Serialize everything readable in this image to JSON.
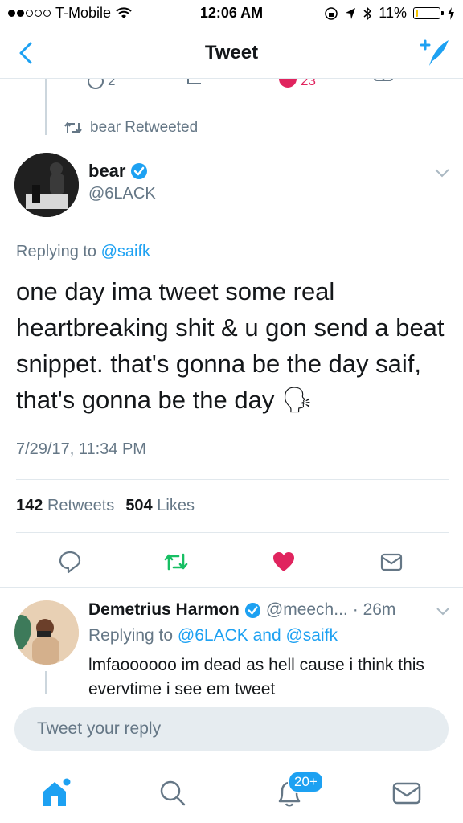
{
  "status": {
    "carrier": "T-Mobile",
    "time": "12:06 AM",
    "battery": "11%",
    "battery_level": 0.11
  },
  "nav": {
    "title": "Tweet"
  },
  "previous_tweet_actions": {
    "reply_count": "2",
    "like_count": "23"
  },
  "retweet_context": "bear Retweeted",
  "tweet": {
    "name": "bear",
    "handle": "@6LACK",
    "replying_prefix": "Replying to",
    "replying_to": "@saifk",
    "text": "one day ima tweet some real heartbreaking shit & u gon send a beat snippet. that's gonna be the day saif, that's gonna be the day",
    "emoji": "🗣",
    "timestamp": "7/29/17, 11:34 PM",
    "retweets_count": "142",
    "retweets_label": "Retweets",
    "likes_count": "504",
    "likes_label": "Likes"
  },
  "reply": {
    "name": "Demetrius Harmon",
    "handle": "@meech...",
    "time": "· 26m",
    "replying_prefix": "Replying to",
    "replying_to": "@6LACK and @saifk",
    "text": "lmfaoooooo im dead as hell cause i think this everytime i see em tweet"
  },
  "composer": {
    "placeholder": "Tweet your reply"
  },
  "tabbar": {
    "notifications_badge": "20+"
  },
  "colors": {
    "accent": "#1da1f2",
    "like": "#e0245e",
    "retweet": "#17bf63",
    "muted": "#657786"
  },
  "icons": [
    "back-chevron-icon",
    "compose-tweet-icon",
    "reply-icon",
    "retweet-icon",
    "heart-icon",
    "dm-icon",
    "verified-icon",
    "caret-down-icon",
    "home-icon",
    "search-icon",
    "notifications-icon",
    "messages-icon"
  ]
}
